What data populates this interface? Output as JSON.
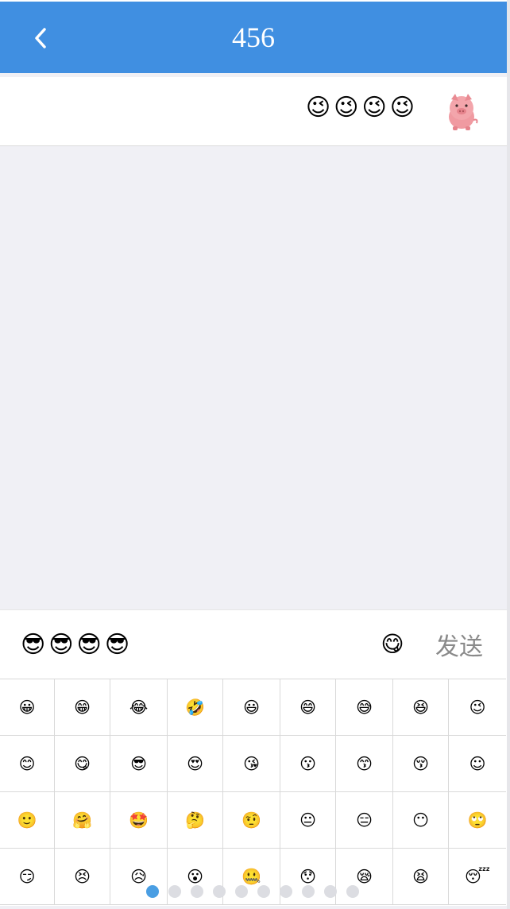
{
  "header": {
    "title": "456",
    "back_icon": "chevron-left-icon"
  },
  "message": {
    "text": "😉😉😉😉",
    "avatar": "pig-avatar-icon"
  },
  "input": {
    "value": "😎😎😎😎",
    "emoji_toggle": "😋",
    "send_label": "发送"
  },
  "emoji_panel": {
    "emojis": [
      "😀",
      "😁",
      "😂",
      "🤣",
      "😃",
      "😄",
      "😅",
      "😆",
      "😉",
      "😊",
      "😋",
      "😎",
      "😍",
      "😘",
      "😗",
      "😙",
      "😚",
      "☺",
      "🙂",
      "🤗",
      "🤩",
      "🤔",
      "🤨",
      "😐",
      "😑",
      "😶",
      "🙄",
      "😏",
      "😣",
      "😥",
      "😮",
      "🤐",
      "😯",
      "😪",
      "😫",
      "😴"
    ],
    "page_count": 10,
    "active_page": 0
  },
  "colors": {
    "header": "#408fe1",
    "dot_active": "#4a9ee3",
    "dot_inactive": "#dcdde2"
  }
}
